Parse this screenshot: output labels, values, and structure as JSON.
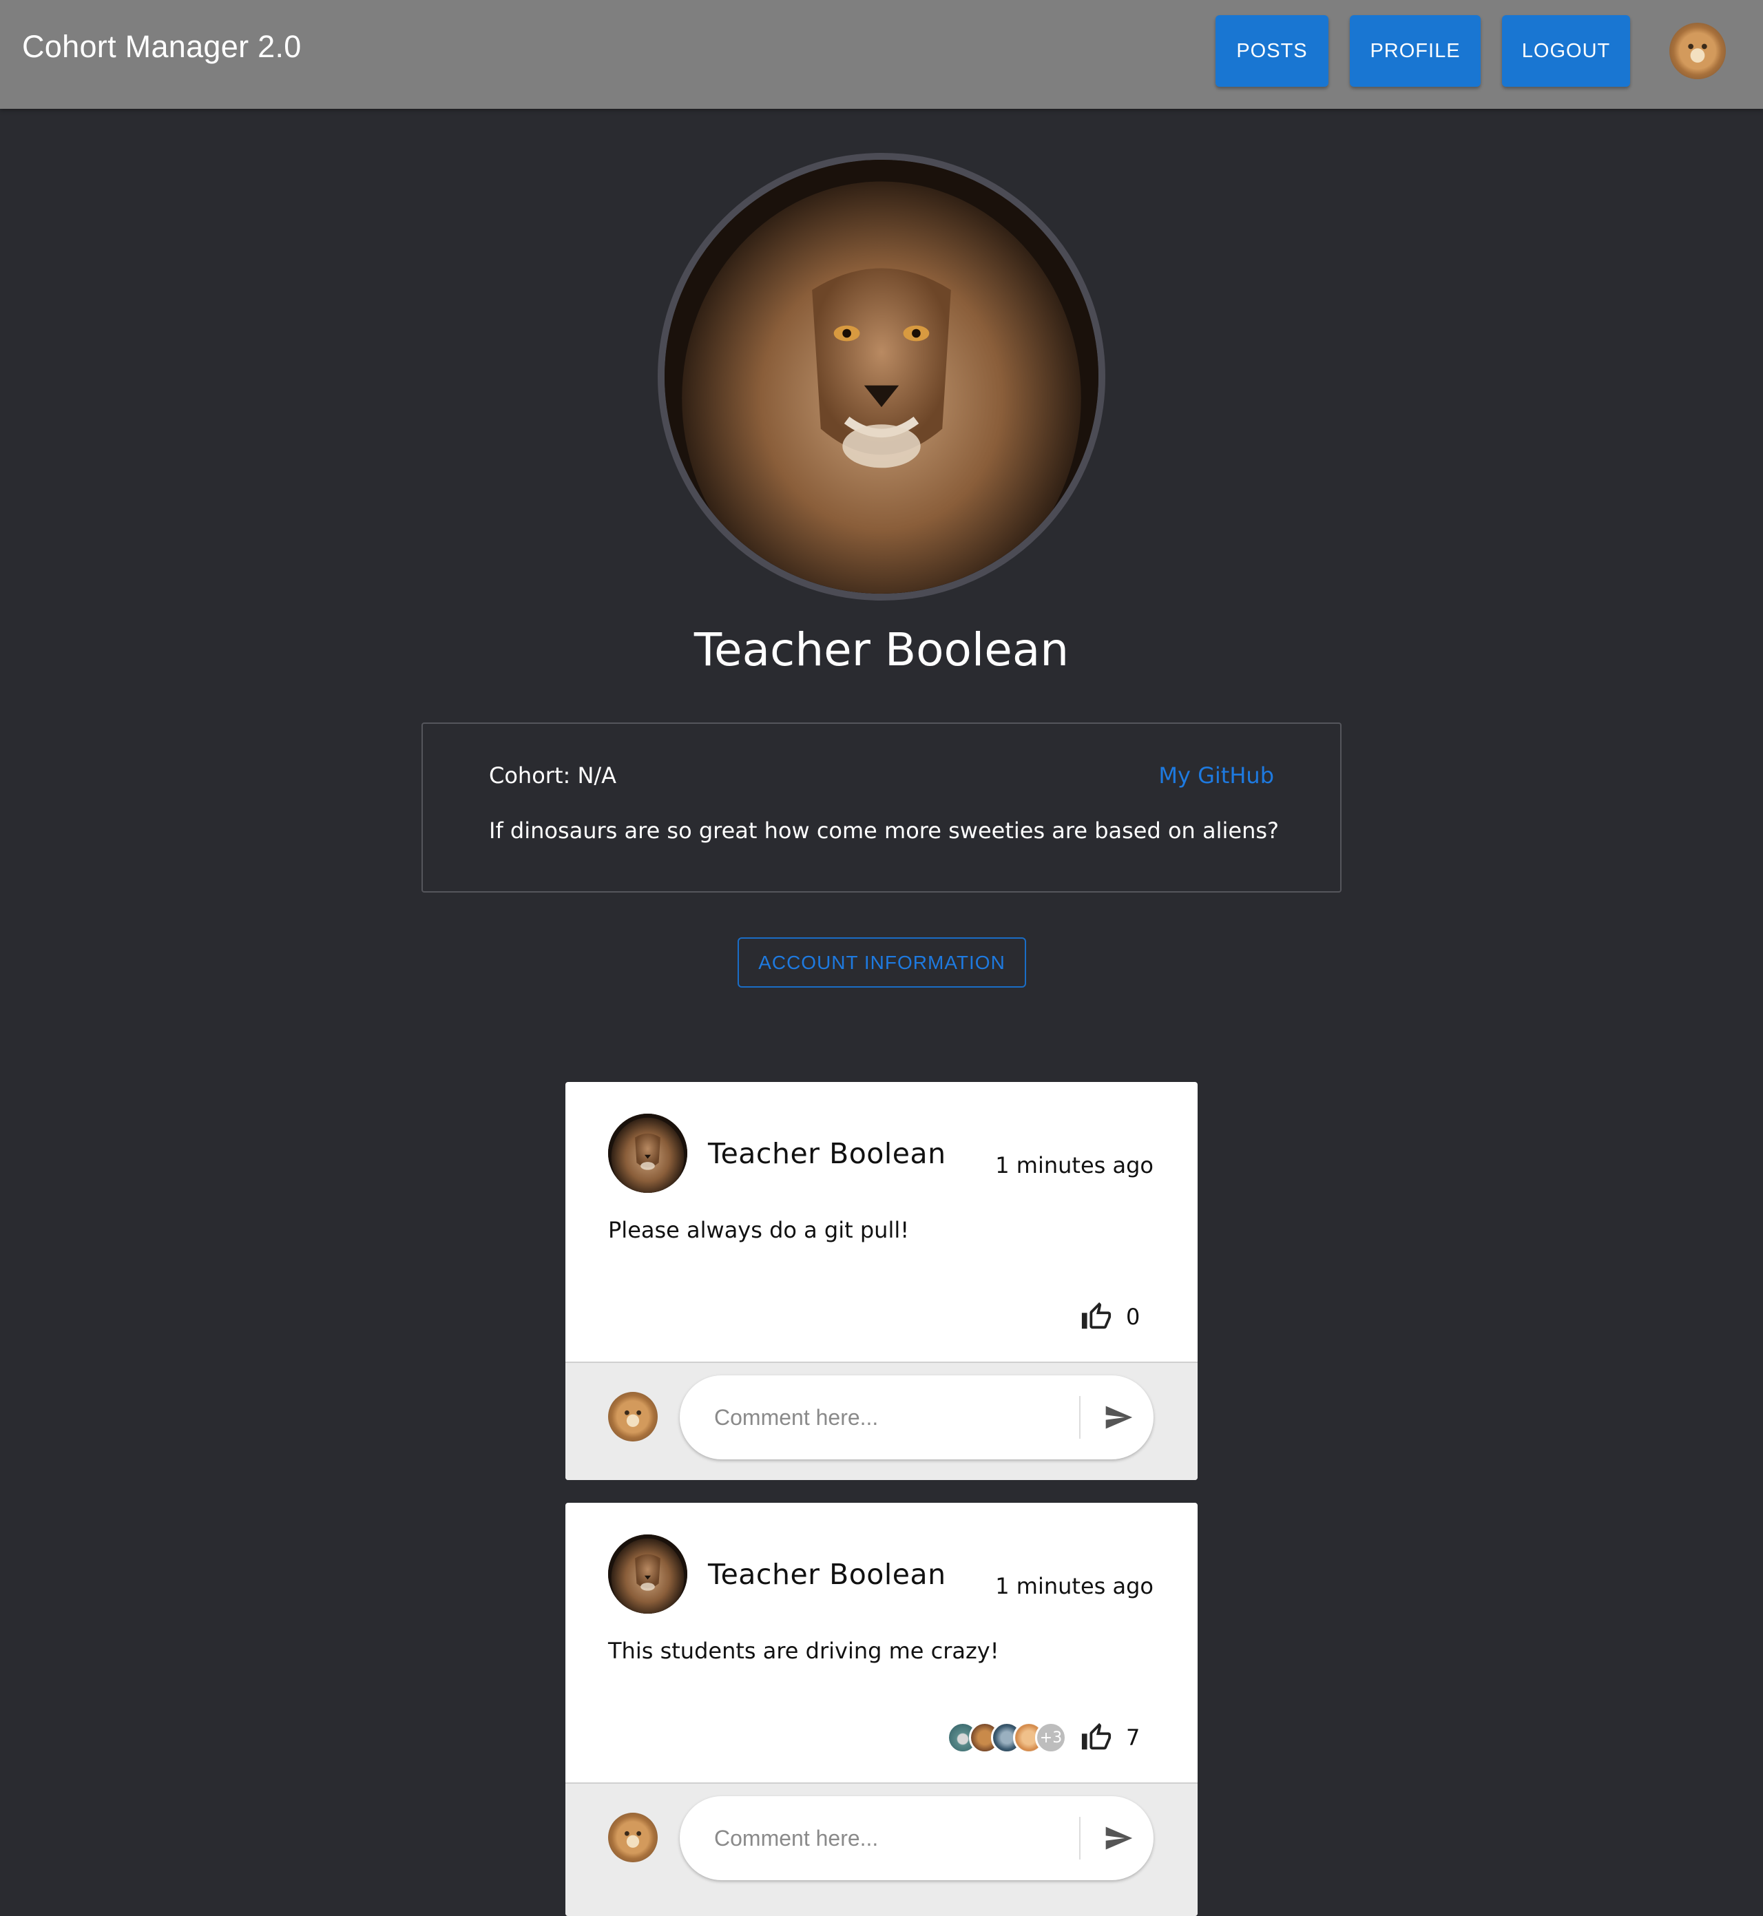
{
  "header": {
    "title": "Cohort Manager 2.0",
    "nav": {
      "posts": "POSTS",
      "profile": "PROFILE",
      "logout": "LOGOUT"
    },
    "accent_color": "#1976d2"
  },
  "profile": {
    "name": "Teacher Boolean",
    "cohort": "Cohort: N/A",
    "github_label": "My GitHub",
    "bio": "If dinosaurs are so great how come more sweeties are based on aliens?",
    "account_button": "ACCOUNT INFORMATION"
  },
  "posts": [
    {
      "author": "Teacher Boolean",
      "time": "1 minutes ago",
      "text": "Please always do a git pull!",
      "likes": "0",
      "likers": [],
      "comment_placeholder": "Comment here..."
    },
    {
      "author": "Teacher Boolean",
      "time": "1 minutes ago",
      "text": "This students are driving me crazy!",
      "likes": "7",
      "likers_more": "+3",
      "comment_placeholder": "Comment here..."
    }
  ],
  "icons": {
    "like": "thumb-up-outline-icon",
    "send": "send-icon"
  }
}
